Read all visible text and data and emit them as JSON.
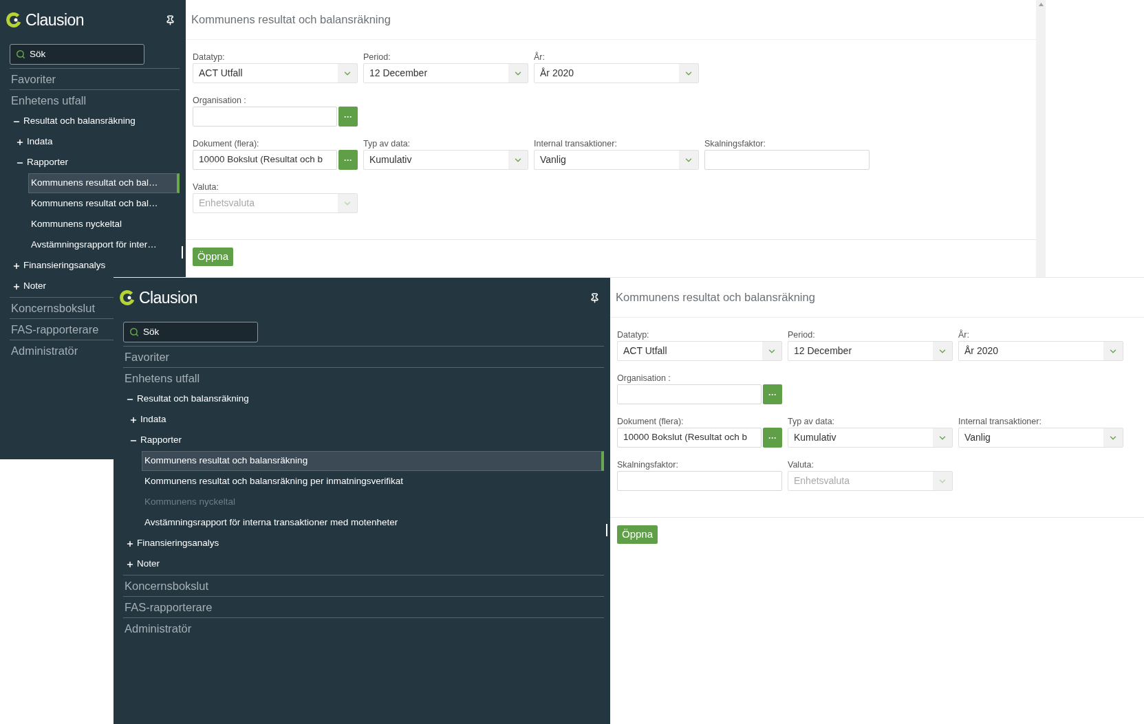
{
  "screens": [
    {
      "sidebar": {
        "logo_text": "Clausion",
        "search_placeholder": "Sök",
        "sections": [
          {
            "label": "Favoriter"
          },
          {
            "label": "Enhetens utfall",
            "children": [
              {
                "label": "Resultat och balansräkning",
                "expanded": true,
                "children": [
                  {
                    "label": "Indata",
                    "expanded": false
                  },
                  {
                    "label": "Rapporter",
                    "expanded": true,
                    "children": [
                      {
                        "label": "Kommunens resultat och bal…",
                        "selected": true,
                        "disabled": false
                      },
                      {
                        "label": "Kommunens resultat och bal…",
                        "selected": false,
                        "disabled": false
                      },
                      {
                        "label": "Kommunens nyckeltal",
                        "selected": false,
                        "disabled": false
                      },
                      {
                        "label": "Avstämningsrapport för inter…",
                        "selected": false,
                        "disabled": false
                      }
                    ]
                  }
                ]
              },
              {
                "label": "Finansieringsanalys",
                "expanded": false
              },
              {
                "label": "Noter",
                "expanded": false
              }
            ]
          },
          {
            "label": "Koncernsbokslut"
          },
          {
            "label": "FAS-rapporterare"
          },
          {
            "label": "Administratör"
          }
        ]
      },
      "main": {
        "title": "Kommunens resultat och balansräkning",
        "form": {
          "rows": [
            [
              {
                "kind": "select",
                "label": "Datatyp:",
                "value": "ACT Utfall",
                "disabled": false
              },
              {
                "kind": "select",
                "label": "Period:",
                "value": "12 December",
                "disabled": false
              },
              {
                "kind": "select",
                "label": "År:",
                "value": "År 2020",
                "disabled": false
              }
            ],
            [
              {
                "kind": "lookup",
                "label": "Organisation :",
                "button": "···"
              }
            ],
            [
              {
                "kind": "lookup",
                "label": "Dokument (flera):",
                "value": "10000 Bokslut (Resultat och b",
                "button": "···"
              },
              {
                "kind": "select",
                "label": "Typ av data:",
                "value": "Kumulativ",
                "disabled": false
              },
              {
                "kind": "select",
                "label": "Internal transaktioner:",
                "value": "Vanlig",
                "disabled": false
              },
              {
                "kind": "text",
                "label": "Skalningsfaktor:"
              }
            ],
            [
              {
                "kind": "select",
                "label": "Valuta:",
                "value": "Enhetsvaluta",
                "disabled": true
              }
            ]
          ]
        },
        "submit": "Öppna"
      }
    },
    {
      "sidebar": {
        "logo_text": "Clausion",
        "search_placeholder": "Sök",
        "sections": [
          {
            "label": "Favoriter"
          },
          {
            "label": "Enhetens utfall",
            "children": [
              {
                "label": "Resultat och balansräkning",
                "expanded": true,
                "children": [
                  {
                    "label": "Indata",
                    "expanded": false
                  },
                  {
                    "label": "Rapporter",
                    "expanded": true,
                    "children": [
                      {
                        "label": "Kommunens resultat och balansräkning",
                        "selected": true,
                        "disabled": false
                      },
                      {
                        "label": "Kommunens resultat och balansräkning per inmatningsverifikat",
                        "selected": false,
                        "disabled": false
                      },
                      {
                        "label": "Kommunens nyckeltal",
                        "selected": false,
                        "disabled": true
                      },
                      {
                        "label": "Avstämningsrapport för interna transaktioner med motenheter",
                        "selected": false,
                        "disabled": false
                      }
                    ]
                  }
                ]
              },
              {
                "label": "Finansieringsanalys",
                "expanded": false
              },
              {
                "label": "Noter",
                "expanded": false
              }
            ]
          },
          {
            "label": "Koncernsbokslut"
          },
          {
            "label": "FAS-rapporterare"
          },
          {
            "label": "Administratör"
          }
        ]
      },
      "main": {
        "title": "Kommunens resultat och balansräkning",
        "form": {
          "rows": [
            [
              {
                "kind": "select",
                "label": "Datatyp:",
                "value": "ACT Utfall",
                "disabled": false
              },
              {
                "kind": "select",
                "label": "Period:",
                "value": "12 December",
                "disabled": false
              },
              {
                "kind": "select",
                "label": "År:",
                "value": "År 2020",
                "disabled": false
              }
            ],
            [
              {
                "kind": "lookup",
                "label": "Organisation :",
                "button": "···"
              }
            ],
            [
              {
                "kind": "lookup",
                "label": "Dokument (flera):",
                "value": "10000 Bokslut (Resultat och b",
                "button": "···"
              },
              {
                "kind": "select",
                "label": "Typ av data:",
                "value": "Kumulativ",
                "disabled": false
              },
              {
                "kind": "select",
                "label": "Internal transaktioner:",
                "value": "Vanlig",
                "disabled": false
              }
            ],
            [
              {
                "kind": "text",
                "label": "Skalningsfaktor:"
              },
              {
                "kind": "select",
                "label": "Valuta:",
                "value": "Enhetsvaluta",
                "disabled": true
              }
            ]
          ]
        },
        "submit": "Öppna"
      }
    }
  ]
}
